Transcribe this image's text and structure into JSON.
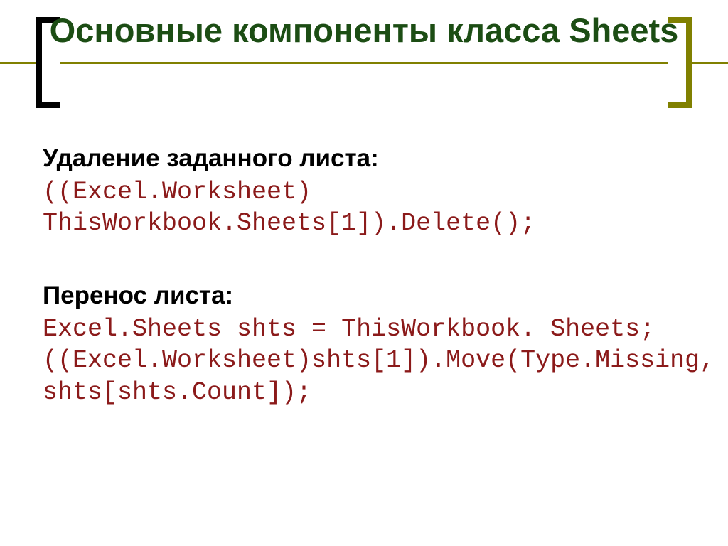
{
  "title": "Основные компоненты класса Sheets",
  "section1": {
    "heading": "Удаление заданного листа:",
    "code": "((Excel.Worksheet) ThisWorkbook.Sheets[1]).Delete();"
  },
  "section2": {
    "heading": "Перенос листа:",
    "code": "Excel.Sheets shts = ThisWorkbook. Sheets;\n((Excel.Worksheet)shts[1]).Move(Type.Missing, shts[shts.Count]);"
  }
}
